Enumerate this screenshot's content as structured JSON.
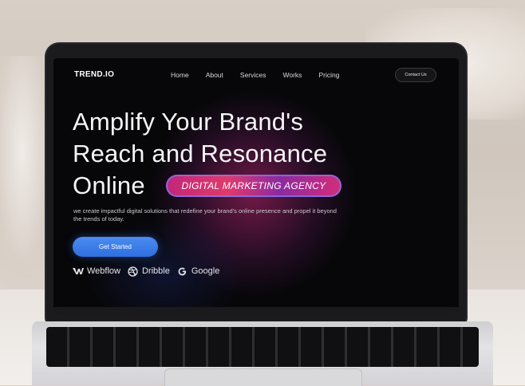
{
  "brand": {
    "logo": "TREND.IO"
  },
  "nav": {
    "links": [
      "Home",
      "About",
      "Services",
      "Works",
      "Pricing"
    ],
    "contact_label": "Contact Us"
  },
  "hero": {
    "headline_lines": [
      "Amplify Your Brand's",
      "Reach and Resonance",
      "Online"
    ],
    "badge": "DIGITAL MARKETING AGENCY",
    "subtext": "we create impactful digital solutions that redefine your brand's online presence and propel it beyond the trends of today.",
    "cta_label": "Get Started"
  },
  "partners": [
    {
      "name": "Webflow",
      "icon": "webflow-icon"
    },
    {
      "name": "Dribble",
      "icon": "dribbble-icon"
    },
    {
      "name": "Google",
      "icon": "google-icon"
    }
  ],
  "colors": {
    "screen_bg": "#07070a",
    "accent_blue": "#2f6fe0",
    "badge_pink": "#e03a6c",
    "glow_magenta": "#c82878"
  }
}
